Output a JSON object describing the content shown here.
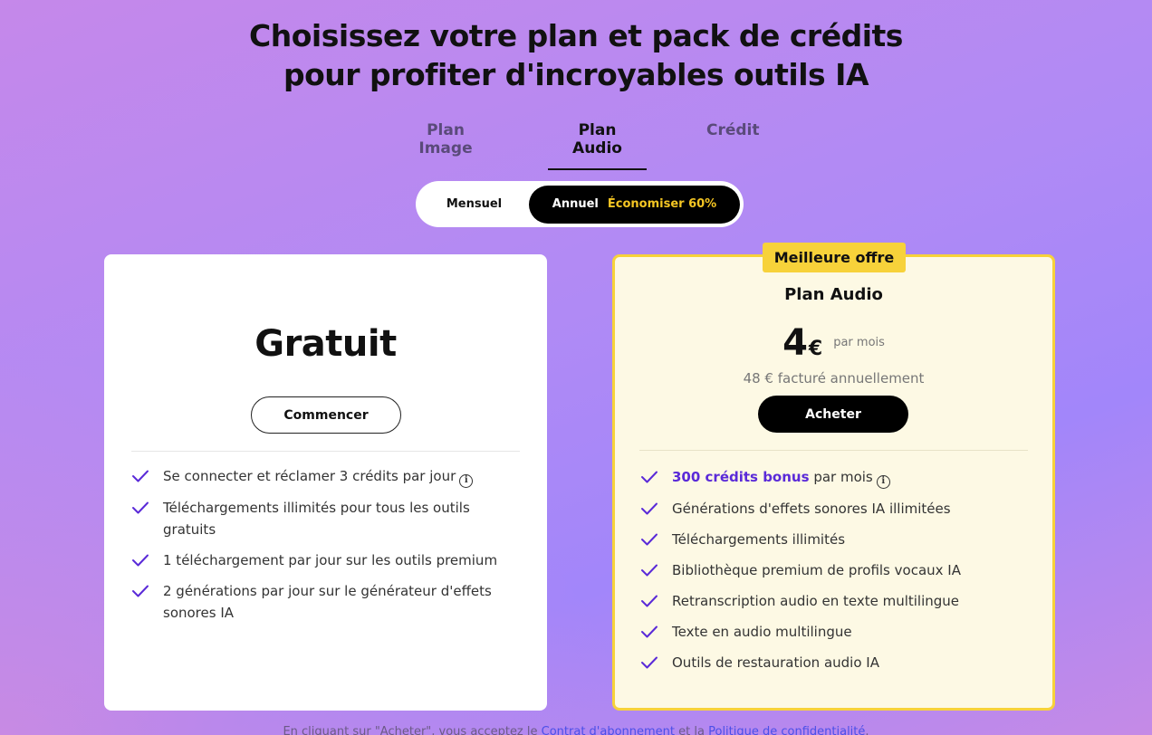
{
  "header": {
    "title_line1": "Choisissez votre plan et pack de crédits",
    "title_line2": "pour profiter d'incroyables outils IA"
  },
  "tabs": [
    {
      "label": "Plan Image",
      "active": false
    },
    {
      "label": "Plan Audio",
      "active": true
    },
    {
      "label": "Crédit",
      "active": false
    }
  ],
  "billing_toggle": {
    "monthly_label": "Mensuel",
    "annual_label": "Annuel",
    "save_label": "Économiser 60%",
    "selected": "Annuel"
  },
  "free_plan": {
    "title": "Gratuit",
    "button_label": "Commencer",
    "features": [
      "Se connecter et réclamer 3 crédits par jour",
      "Téléchargements illimités pour tous les outils gratuits",
      "1 téléchargement par jour sur les outils premium",
      "2 générations par jour sur le générateur d'effets sonores IA"
    ]
  },
  "audio_plan": {
    "badge": "Meilleure offre",
    "title": "Plan Audio",
    "price": "4",
    "currency": "€",
    "period": "par mois",
    "billed": "48 € facturé annuellement",
    "button_label": "Acheter",
    "bonus_highlight": "300 crédits bonus",
    "bonus_suffix": "par mois",
    "features": [
      "Générations d'effets sonores IA illimitées",
      "Téléchargements illimités",
      "Bibliothèque premium de profils vocaux IA",
      "Retranscription audio en texte multilingue",
      "Texte en audio multilingue",
      "Outils de restauration audio IA"
    ]
  },
  "footer": {
    "prefix": "En cliquant sur \"Acheter\", vous acceptez le ",
    "link1": "Contrat d'abonnement",
    "middle": " et la ",
    "link2": "Politique de confidentialité",
    "suffix": "."
  },
  "colors": {
    "accent_purple": "#5a2ad8",
    "check_purple": "#5a2ad8",
    "badge_yellow": "#f7d23a",
    "save_yellow": "#f5c623",
    "audio_card_bg": "#fdf9e4"
  }
}
